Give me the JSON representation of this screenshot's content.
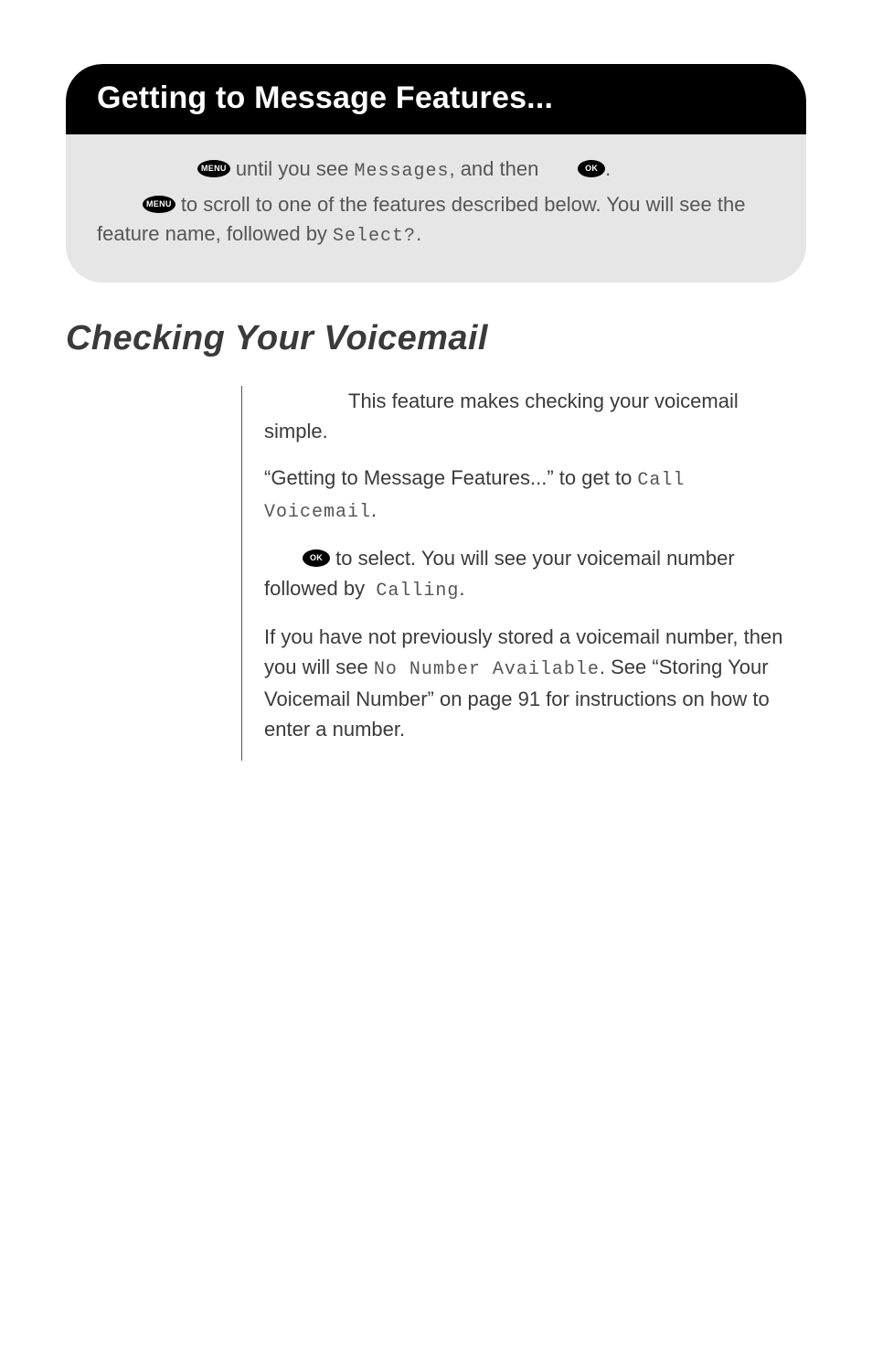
{
  "heading": {
    "title": "Getting to Message Features...",
    "line1_pre": " until you see ",
    "line1_mono": "Messages",
    "line1_post": ", and then ",
    "line1_end": ".",
    "line2_pre": " to scroll to one of the features described below. You will see the feature name, followed by ",
    "line2_mono": "Select?",
    "line2_end": "."
  },
  "section_title": "Checking Your Voicemail",
  "body": {
    "p1": "This feature makes checking your voicemail simple.",
    "p2_pre": "“Getting to Message Features...” to get to ",
    "p2_mono": "Call Voicemail",
    "p2_end": ".",
    "p3_pre": " to select. You will see your voicemail number followed by ",
    "p3_mono": "Calling",
    "p3_end": ".",
    "p4_pre": "If you have not previously stored a voicemail number, then you will see ",
    "p4_mono": "No Number Available",
    "p4_post": ". See “Storing Your Voicemail Number” on page 91 for instructions on how to enter a number."
  },
  "icons": {
    "menu": "MENU",
    "ok": "OK"
  }
}
